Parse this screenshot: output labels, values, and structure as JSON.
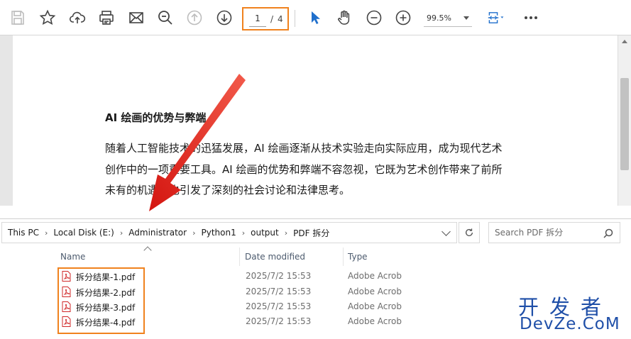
{
  "pdf_viewer": {
    "page_current": "1",
    "page_separator": "/",
    "page_total": "4",
    "zoom": "99.5%",
    "content": {
      "heading": "AI 绘画的优势与弊端",
      "lines": [
        "随着人工智能技术的迅猛发展，AI 绘画逐渐从技术实验走向实际应用，成为现代艺术",
        "创作中的一项重要工具。AI 绘画的优势和弊端不容忽视，它既为艺术创作带来了前所",
        "未有的机遇，也引发了深刻的社会讨论和法律思考。"
      ]
    },
    "toolbar_icons": [
      "save-icon",
      "star-icon",
      "cloud-upload-icon",
      "print-icon",
      "mail-icon",
      "zoom-search-icon",
      "page-up-icon",
      "page-down-icon",
      "cursor-icon",
      "hand-icon",
      "zoom-out-icon",
      "zoom-in-icon",
      "fit-page-icon",
      "more-icon"
    ],
    "accent_color": "#f0821e"
  },
  "explorer": {
    "breadcrumb": [
      "This PC",
      "Local Disk (E:)",
      "Administrator",
      "Python1",
      "output",
      "PDF 拆分"
    ],
    "search_placeholder": "Search PDF 拆分",
    "columns": {
      "name": "Name",
      "date": "Date modified",
      "type": "Type"
    },
    "files": [
      {
        "name": "拆分结果-1.pdf",
        "date": "2025/7/2 15:53",
        "type": "Adobe Acroba"
      },
      {
        "name": "拆分结果-2.pdf",
        "date": "2025/7/2 15:53",
        "type": "Adobe Acroba"
      },
      {
        "name": "拆分结果-3.pdf",
        "date": "2025/7/2 15:53",
        "type": "Adobe Acroba"
      },
      {
        "name": "拆分结果-4.pdf",
        "date": "2025/7/2 15:53",
        "type": "Adobe Acroba"
      }
    ]
  },
  "watermark": {
    "top": "开发者",
    "bottom": "DevZe.CoM"
  },
  "colors": {
    "highlight": "#f0821e",
    "arrow": "#e0201a",
    "watermark": "#1f4fa8",
    "pdf_icon": "#d0282a"
  }
}
